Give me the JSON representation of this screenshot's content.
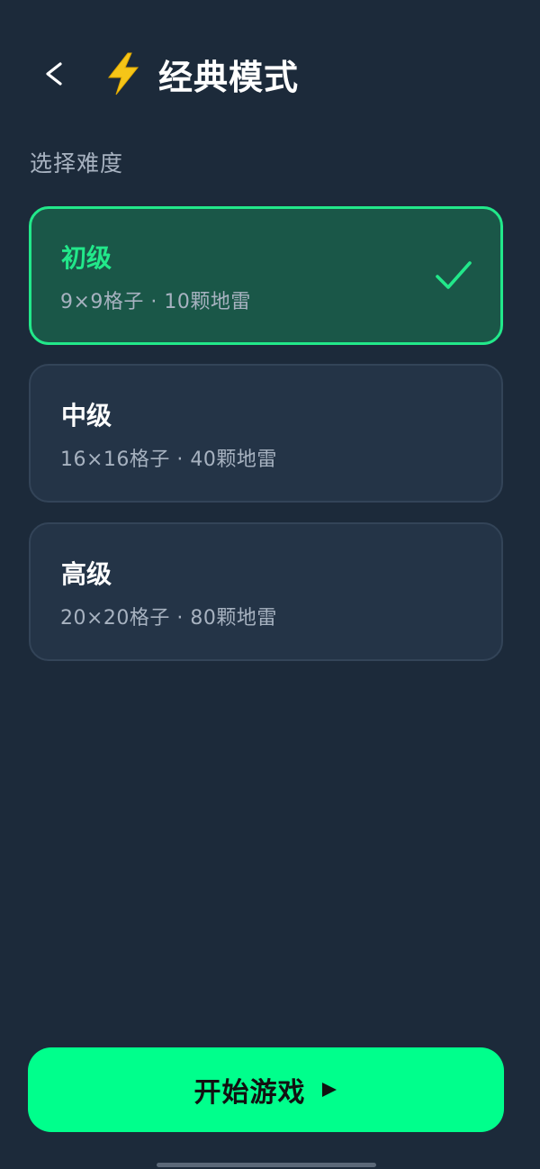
{
  "header": {
    "back_icon": "chevron-left-icon",
    "title_icon": "lightning-icon",
    "title": "经典模式"
  },
  "section_label": "选择难度",
  "difficulties": [
    {
      "title": "初级",
      "desc": "9×9格子 · 10颗地雷",
      "selected": true
    },
    {
      "title": "中级",
      "desc": "16×16格子 · 40颗地雷",
      "selected": false
    },
    {
      "title": "高级",
      "desc": "20×20格子 · 80颗地雷",
      "selected": false
    }
  ],
  "start_button": {
    "label": "开始游戏",
    "icon": "play-icon"
  },
  "colors": {
    "background": "#1c2a3a",
    "card": "#243447",
    "selected_card": "#1a5748",
    "accent": "#22e88a",
    "button": "#00ff8c",
    "muted_text": "#a7b2c0",
    "bolt": "#f5c518"
  }
}
